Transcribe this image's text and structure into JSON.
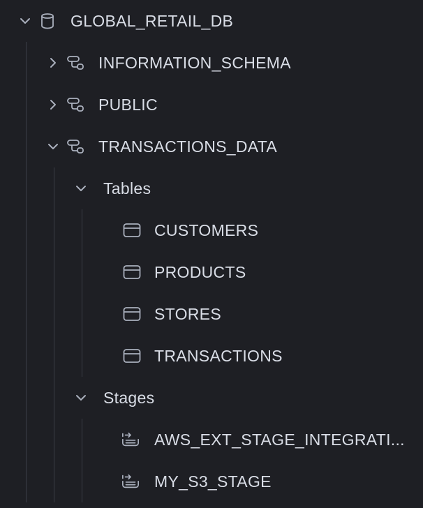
{
  "tree": {
    "database": {
      "label": "GLOBAL_RETAIL_DB",
      "icon": "database-icon",
      "expanded": true
    },
    "schemas": [
      {
        "label": "INFORMATION_SCHEMA",
        "icon": "schema-icon",
        "expanded": false
      },
      {
        "label": "PUBLIC",
        "icon": "schema-icon",
        "expanded": false
      },
      {
        "label": "TRANSACTIONS_DATA",
        "icon": "schema-icon",
        "expanded": true
      }
    ],
    "groups": {
      "tables": {
        "label": "Tables",
        "expanded": true,
        "items": [
          {
            "label": "CUSTOMERS",
            "icon": "table-icon"
          },
          {
            "label": "PRODUCTS",
            "icon": "table-icon"
          },
          {
            "label": "STORES",
            "icon": "table-icon"
          },
          {
            "label": "TRANSACTIONS",
            "icon": "table-icon"
          }
        ]
      },
      "stages": {
        "label": "Stages",
        "expanded": true,
        "items": [
          {
            "label": "AWS_EXT_STAGE_INTEGRATI...",
            "icon": "stage-icon"
          },
          {
            "label": "MY_S3_STAGE",
            "icon": "stage-icon"
          }
        ]
      }
    }
  },
  "colors": {
    "background": "#1e1f24",
    "text": "#d9dde6",
    "icon": "#aab0bd",
    "guide": "#3a3d46"
  }
}
